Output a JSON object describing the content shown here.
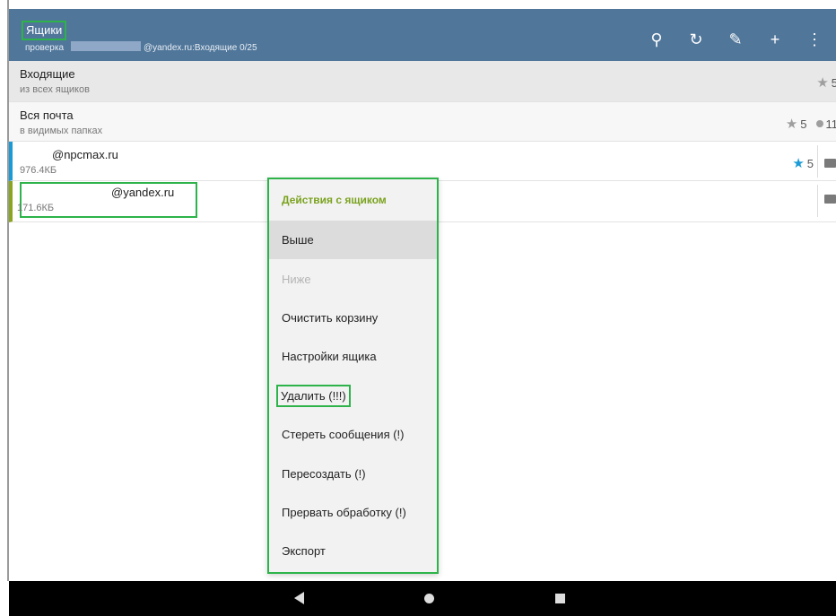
{
  "toolbar": {
    "title": "Ящики",
    "subtitle_prefix": "проверка",
    "subtitle_suffix": "@yandex.ru:Входящие 0/25",
    "icons": [
      "search-icon",
      "refresh-icon",
      "edit-icon",
      "add-icon",
      "more-icon"
    ],
    "icon_glyphs": {
      "search": "⚲",
      "refresh": "↻",
      "edit": "✎",
      "add": "+",
      "more": "⋮"
    },
    "background": "#50769a"
  },
  "list": {
    "inbox": {
      "title": "Входящие",
      "subtitle": "из всех ящиков",
      "stars": "5"
    },
    "all_mail": {
      "title": "Вся почта",
      "subtitle": "в видимых папках",
      "stars": "5",
      "unread": "11"
    },
    "accounts": [
      {
        "email": "@npcmax.ru",
        "size": "976.4КБ",
        "stars": "5",
        "color": "#1a9ad6"
      },
      {
        "email": "@yandex.ru",
        "size": "171.6КБ",
        "color": "#8aa51e"
      }
    ]
  },
  "menu": {
    "header": "Действия с ящиком",
    "items": [
      {
        "label": "Выше",
        "state": "highlighted"
      },
      {
        "label": "Ниже",
        "state": "disabled"
      },
      {
        "label": "Очистить корзину"
      },
      {
        "label": "Настройки ящика"
      },
      {
        "label": "Удалить (!!!)"
      },
      {
        "label": "Стереть сообщения (!)"
      },
      {
        "label": "Пересоздать (!)"
      },
      {
        "label": "Прервать обработку (!)"
      },
      {
        "label": "Экспорт"
      }
    ]
  },
  "navbar": {
    "icons": [
      "back-icon",
      "home-icon",
      "recents-icon"
    ]
  },
  "colors": {
    "accent_green": "#2db34a",
    "header_green": "#7aa21e",
    "star_blue": "#1a9ad6"
  }
}
